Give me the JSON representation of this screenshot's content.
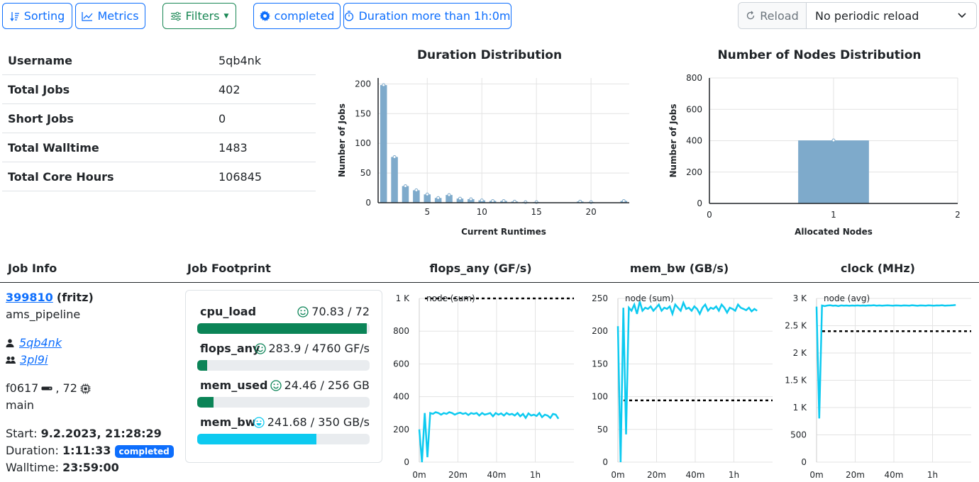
{
  "toolbar": {
    "sorting": "Sorting",
    "metrics": "Metrics",
    "filters": "Filters",
    "state_filter": "completed",
    "duration_filter": "Duration more than 1h:0m",
    "reload": "Reload",
    "reload_select": "No periodic reload"
  },
  "colors": {
    "primary": "#0d6efd",
    "success": "#198754",
    "bar": "#7eaacb",
    "cyan": "#0dcaf0",
    "green_fill": "#0b8457"
  },
  "stats": [
    {
      "label": "Username",
      "value": "5qb4nk"
    },
    {
      "label": "Total Jobs",
      "value": "402"
    },
    {
      "label": "Short Jobs",
      "value": "0"
    },
    {
      "label": "Total Walltime",
      "value": "1483"
    },
    {
      "label": "Total Core Hours",
      "value": "106845"
    }
  ],
  "charts_text": {
    "duration_title": "Duration Distribution",
    "duration_xlabel": "Current Runtimes",
    "duration_ylabel": "Number of Jobs",
    "nodes_title": "Number of Nodes Distribution",
    "nodes_xlabel": "Allocated Nodes",
    "nodes_ylabel": "Number of Jobs",
    "flops_title": "flops_any (GF/s)",
    "flops_series": "node (sum)",
    "membw_title": "mem_bw (GB/s)",
    "membw_series": "node (sum)",
    "clock_title": "clock (MHz)",
    "clock_series": "node (avg)"
  },
  "chart_data": [
    {
      "type": "bar",
      "title": "Duration Distribution",
      "xlabel": "Current Runtimes",
      "ylabel": "Number of Jobs",
      "x": [
        1,
        2,
        3,
        4,
        5,
        6,
        7,
        8,
        9,
        10,
        11,
        12,
        13,
        14,
        15,
        16,
        17,
        18,
        19,
        20,
        21,
        22,
        23
      ],
      "values": [
        198,
        77,
        28,
        21,
        14,
        8,
        13,
        7,
        6,
        4,
        3,
        3,
        2,
        1,
        1,
        0,
        0,
        0,
        2,
        1,
        0,
        0,
        3
      ],
      "xticks": [
        5,
        10,
        15,
        20
      ],
      "yticks": [
        0,
        50,
        100,
        150,
        200
      ],
      "ylim": [
        0,
        210
      ]
    },
    {
      "type": "bar",
      "title": "Number of Nodes Distribution",
      "xlabel": "Allocated Nodes",
      "ylabel": "Number of Jobs",
      "x": [
        1
      ],
      "values": [
        402
      ],
      "xticks": [
        0,
        1,
        2
      ],
      "yticks": [
        0,
        200,
        400,
        600,
        800
      ],
      "ylim": [
        0,
        800
      ]
    },
    {
      "type": "line",
      "title": "flops_any (GF/s)",
      "series": [
        {
          "name": "node (sum)",
          "values": [
            200,
            0,
            300,
            30,
            300,
            295,
            305,
            300,
            290,
            300,
            295,
            305,
            300,
            290,
            298,
            302,
            295,
            300,
            288,
            300,
            295,
            300,
            285,
            300,
            290,
            295,
            300,
            280,
            300,
            290,
            298,
            285,
            300,
            290,
            295,
            285,
            300,
            280,
            295,
            270,
            298,
            285,
            290,
            282,
            300,
            275,
            290,
            285,
            270,
            295,
            290,
            265
          ]
        }
      ],
      "threshold": 1000,
      "yticks": [
        "0",
        "200",
        "400",
        "600",
        "800",
        "1 K"
      ],
      "ylim": [
        0,
        1000
      ],
      "xticks": [
        "0m",
        "20m",
        "40m",
        "1h"
      ]
    },
    {
      "type": "line",
      "title": "mem_bw (GB/s)",
      "series": [
        {
          "name": "node (sum)",
          "values": [
            220,
            0,
            250,
            45,
            250,
            245,
            255,
            240,
            260,
            245,
            250,
            248,
            252,
            245,
            250,
            255,
            245,
            250,
            248,
            252,
            240,
            255,
            250,
            245,
            258,
            248,
            250,
            245,
            252,
            248,
            240,
            250,
            255,
            245,
            250,
            248,
            252,
            245,
            255,
            250,
            242,
            250,
            248,
            245,
            255,
            250,
            248,
            246,
            250,
            244,
            248,
            245
          ]
        }
      ],
      "threshold": 100,
      "yticks": [
        "0",
        "50",
        "100",
        "150",
        "200",
        "250"
      ],
      "ylim": [
        0,
        265
      ],
      "xticks": [
        "0m",
        "20m",
        "40m",
        "1h"
      ]
    },
    {
      "type": "line",
      "title": "clock (MHz)",
      "series": [
        {
          "name": "node (avg)",
          "values": [
            2850,
            800,
            2870,
            2860,
            2870,
            2875,
            2865,
            2870,
            2860,
            2872,
            2868,
            2870,
            2865,
            2870,
            2868,
            2872,
            2866,
            2870,
            2868,
            2872,
            2870,
            2875,
            2868,
            2872,
            2866,
            2870,
            2874,
            2870,
            2868,
            2872,
            2870,
            2866,
            2872,
            2870,
            2868,
            2875,
            2870,
            2865,
            2872,
            2870,
            2868,
            2874,
            2870,
            2866,
            2872,
            2870,
            2875,
            2868,
            2870,
            2872,
            2875,
            2880
          ]
        }
      ],
      "threshold": 2400,
      "yticks": [
        "0",
        "500",
        "1 K",
        "1.5 K",
        "2 K",
        "2.5 K",
        "3 K"
      ],
      "ylim": [
        0,
        3000
      ],
      "xticks": [
        "0m",
        "20m",
        "40m",
        "1h"
      ]
    }
  ],
  "table": {
    "headers": [
      "Job Info",
      "Job Footprint",
      "flops_any (GF/s)",
      "mem_bw (GB/s)",
      "clock (MHz)"
    ]
  },
  "job": {
    "id": "399810",
    "cluster": "(fritz)",
    "project": "ams_pipeline",
    "user": "5qb4nk",
    "group": "3pl9i",
    "host": "f0617",
    "cores": ", 72",
    "partition": "main",
    "start_label": "Start: ",
    "start": "9.2.2023, 21:28:29",
    "duration_label": "Duration: ",
    "duration": "1:11:33",
    "state": "completed",
    "walltime_label": "Walltime: ",
    "walltime": "23:59:00"
  },
  "footprint": [
    {
      "name": "cpu_load",
      "value": "70.83 / 72",
      "fill": 0.9837,
      "color": "#0b8457"
    },
    {
      "name": "flops_any",
      "value": "283.9 / 4760 GF/s",
      "fill": 0.0596,
      "color": "#0b8457"
    },
    {
      "name": "mem_used",
      "value": "24.46 / 256 GB",
      "fill": 0.0955,
      "color": "#0b8457"
    },
    {
      "name": "mem_bw",
      "value": "241.68 / 350 GB/s",
      "fill": 0.6905,
      "color": "#0dcaf0"
    }
  ]
}
